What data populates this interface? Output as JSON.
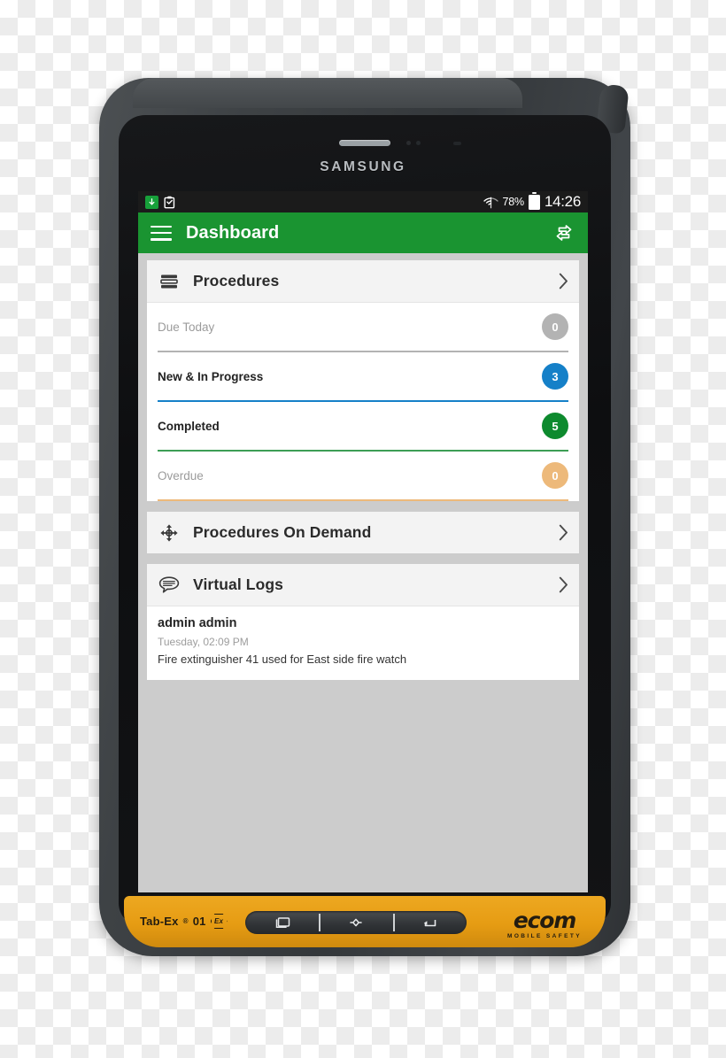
{
  "device": {
    "brand": "SAMSUNG",
    "model_label": "Tab-Ex",
    "model_sup": "®",
    "model_number": "01",
    "ex_mark": "Ex",
    "vendor_logo": "ecom",
    "vendor_tagline": "MOBILE SAFETY",
    "nav_keys": [
      {
        "name": "recent-apps-key"
      },
      {
        "name": "home-key"
      },
      {
        "name": "back-key"
      }
    ]
  },
  "status_bar": {
    "left_icons": [
      {
        "name": "app-badge-icon",
        "glyph": "↓"
      },
      {
        "name": "clipboard-icon"
      }
    ],
    "wifi_icon": "wifi-icon",
    "battery_percent": "78%",
    "battery_icon": "battery-icon",
    "time": "14:26"
  },
  "app_bar": {
    "menu_icon": "hamburger-menu-icon",
    "title": "Dashboard",
    "action_icon": "sync-transfer-icon",
    "background_color": "#1a9431"
  },
  "cards": {
    "procedures": {
      "icon": "layers-list-icon",
      "title": "Procedures",
      "chevron": "chevron-right-icon",
      "rows": [
        {
          "label": "Due Today",
          "count": "0",
          "color": "#b3b3b3",
          "muted": true
        },
        {
          "label": "New & In Progress",
          "count": "3",
          "color": "#1580c8",
          "muted": false
        },
        {
          "label": "Completed",
          "count": "5",
          "color": "#0d8a2e",
          "muted": false
        },
        {
          "label": "Overdue",
          "count": "0",
          "color": "#edb97a",
          "muted": true
        }
      ]
    },
    "procedures_on_demand": {
      "icon": "move-arrows-icon",
      "title": "Procedures On Demand",
      "chevron": "chevron-right-icon"
    },
    "virtual_logs": {
      "icon": "speech-bubble-icon",
      "title": "Virtual Logs",
      "chevron": "chevron-right-icon",
      "entry": {
        "user": "admin admin",
        "timestamp": "Tuesday, 02:09 PM",
        "text": "Fire extinguisher 41 used for East side fire watch"
      }
    }
  }
}
